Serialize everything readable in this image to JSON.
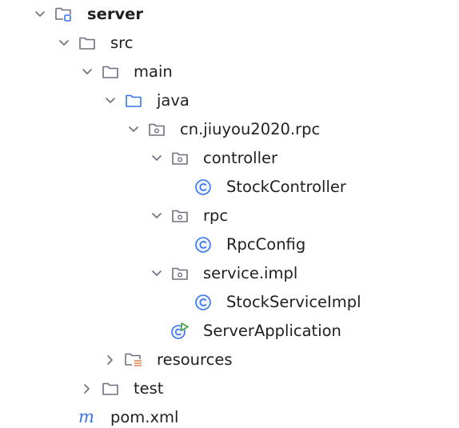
{
  "tree": {
    "nodes": [
      {
        "id": "server",
        "label": "server",
        "icon": "module-folder-icon",
        "chevron": "expanded",
        "bold": true
      },
      {
        "id": "src",
        "label": "src",
        "icon": "folder-icon",
        "chevron": "expanded"
      },
      {
        "id": "main",
        "label": "main",
        "icon": "folder-icon",
        "chevron": "expanded"
      },
      {
        "id": "java",
        "label": "java",
        "icon": "source-folder-icon",
        "chevron": "expanded"
      },
      {
        "id": "package-root",
        "label": "cn.jiuyou2020.rpc",
        "icon": "package-icon",
        "chevron": "expanded"
      },
      {
        "id": "controller",
        "label": "controller",
        "icon": "package-icon",
        "chevron": "expanded"
      },
      {
        "id": "stock-controller",
        "label": "StockController",
        "icon": "class-icon",
        "chevron": "none"
      },
      {
        "id": "rpc",
        "label": "rpc",
        "icon": "package-icon",
        "chevron": "expanded"
      },
      {
        "id": "rpc-config",
        "label": "RpcConfig",
        "icon": "class-icon",
        "chevron": "none"
      },
      {
        "id": "service-impl",
        "label": "service.impl",
        "icon": "package-icon",
        "chevron": "expanded"
      },
      {
        "id": "stock-service-impl",
        "label": "StockServiceImpl",
        "icon": "class-icon",
        "chevron": "none"
      },
      {
        "id": "server-application",
        "label": "ServerApplication",
        "icon": "spring-boot-class-icon",
        "chevron": "none"
      },
      {
        "id": "resources",
        "label": "resources",
        "icon": "resources-folder-icon",
        "chevron": "collapsed"
      },
      {
        "id": "test",
        "label": "test",
        "icon": "folder-icon",
        "chevron": "collapsed"
      },
      {
        "id": "pom-xml",
        "label": "pom.xml",
        "icon": "maven-icon",
        "chevron": "none"
      }
    ]
  },
  "colors": {
    "text": "#1f1f1f",
    "icon_gray": "#6c707e",
    "source_blue": "#3574f0",
    "class_blue": "#3574f0",
    "resources_orange": "#e08855",
    "run_green": "#43a047"
  }
}
